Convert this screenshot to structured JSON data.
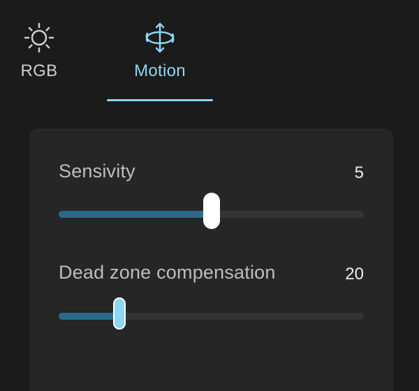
{
  "tabs": [
    {
      "label": "RGB",
      "icon": "sun-icon",
      "active": false
    },
    {
      "label": "Motion",
      "icon": "rotate-arrows-icon",
      "active": true
    }
  ],
  "colors": {
    "accent": "#8fd6f3",
    "fill": "#2c6a88",
    "card": "#262626",
    "background": "#1b1b1b"
  },
  "settings": {
    "sensitivity": {
      "label": "Sensivity",
      "value": "5",
      "fraction": 0.5
    },
    "dead_zone": {
      "label": "Dead zone compensation",
      "value": "20",
      "fraction": 0.2
    }
  }
}
